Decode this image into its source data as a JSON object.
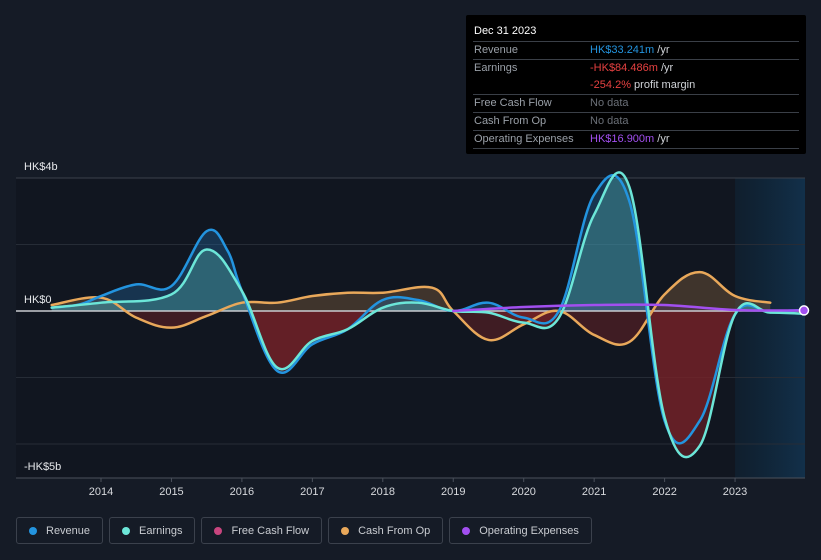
{
  "tooltip": {
    "date": "Dec 31 2023",
    "rows": [
      {
        "label": "Revenue",
        "value": "HK$33.241m",
        "unit": "/yr",
        "color": "#2394df"
      },
      {
        "label": "Earnings",
        "value": "-HK$84.486m",
        "unit": "/yr",
        "color": "#e64141"
      },
      {
        "label": "",
        "value": "-254.2%",
        "unit": "profit margin",
        "color": "#e64141"
      },
      {
        "label": "Free Cash Flow",
        "value": "No data",
        "unit": "",
        "color": "#6b7078"
      },
      {
        "label": "Cash From Op",
        "value": "No data",
        "unit": "",
        "color": "#6b7078"
      },
      {
        "label": "Operating Expenses",
        "value": "HK$16.900m",
        "unit": "/yr",
        "color": "#a24ff0"
      }
    ]
  },
  "legend": [
    {
      "label": "Revenue",
      "color": "#2394df"
    },
    {
      "label": "Earnings",
      "color": "#6ce6d8"
    },
    {
      "label": "Free Cash Flow",
      "color": "#c8457e"
    },
    {
      "label": "Cash From Op",
      "color": "#e9a85a"
    },
    {
      "label": "Operating Expenses",
      "color": "#a24ff0"
    }
  ],
  "chart_data": {
    "type": "area",
    "title": "",
    "xlabel": "",
    "ylabel": "",
    "y_unit": "HK$ billions",
    "ylim": [
      -5,
      4
    ],
    "xlim": [
      2012.8,
      2024.0
    ],
    "y_tick_labels": [
      {
        "value": 4,
        "label": "HK$4b"
      },
      {
        "value": 0,
        "label": "HK$0"
      },
      {
        "value": -5,
        "label": "-HK$5b"
      }
    ],
    "gridlines": [
      4,
      2,
      0,
      -2,
      -4
    ],
    "x_ticks": [
      2014,
      2015,
      2016,
      2017,
      2018,
      2019,
      2020,
      2021,
      2022,
      2023
    ],
    "forecast_shade_start": 2023.0,
    "grid": true,
    "legend_position": "bottom",
    "series": [
      {
        "name": "Revenue",
        "color": "#2394df",
        "points": [
          [
            2013.3,
            0.1
          ],
          [
            2013.7,
            0.2
          ],
          [
            2014.0,
            0.45
          ],
          [
            2014.5,
            0.8
          ],
          [
            2015.0,
            0.75
          ],
          [
            2015.5,
            2.4
          ],
          [
            2015.8,
            1.8
          ],
          [
            2016.0,
            0.6
          ],
          [
            2016.5,
            -1.8
          ],
          [
            2017.0,
            -1.0
          ],
          [
            2017.5,
            -0.55
          ],
          [
            2018.0,
            0.33
          ],
          [
            2018.5,
            0.33
          ],
          [
            2019.0,
            0.0
          ],
          [
            2019.5,
            0.25
          ],
          [
            2020.0,
            -0.2
          ],
          [
            2020.5,
            0.0
          ],
          [
            2021.0,
            3.5
          ],
          [
            2021.5,
            3.3
          ],
          [
            2022.0,
            -3.3
          ],
          [
            2022.5,
            -3.3
          ],
          [
            2023.0,
            -0.1
          ],
          [
            2023.5,
            -0.02
          ],
          [
            2024.0,
            0.033
          ]
        ]
      },
      {
        "name": "Earnings",
        "color": "#6ce6d8",
        "points": [
          [
            2013.3,
            0.1
          ],
          [
            2014.0,
            0.25
          ],
          [
            2015.0,
            0.5
          ],
          [
            2015.5,
            1.85
          ],
          [
            2016.0,
            0.6
          ],
          [
            2016.5,
            -1.7
          ],
          [
            2017.0,
            -0.9
          ],
          [
            2017.5,
            -0.55
          ],
          [
            2018.0,
            0.1
          ],
          [
            2018.5,
            0.25
          ],
          [
            2019.0,
            0.0
          ],
          [
            2019.5,
            -0.05
          ],
          [
            2020.0,
            -0.35
          ],
          [
            2020.5,
            -0.2
          ],
          [
            2021.0,
            2.9
          ],
          [
            2021.5,
            3.73
          ],
          [
            2022.0,
            -3.2
          ],
          [
            2022.5,
            -4.05
          ],
          [
            2023.0,
            -0.1
          ],
          [
            2023.5,
            -0.05
          ],
          [
            2024.0,
            -0.085
          ]
        ]
      },
      {
        "name": "Free Cash Flow",
        "color": "#c8457e",
        "points": []
      },
      {
        "name": "Cash From Op",
        "color": "#e9a85a",
        "points": [
          [
            2013.3,
            0.18
          ],
          [
            2014.0,
            0.4
          ],
          [
            2014.5,
            -0.2
          ],
          [
            2015.0,
            -0.5
          ],
          [
            2015.5,
            -0.15
          ],
          [
            2016.0,
            0.25
          ],
          [
            2016.5,
            0.25
          ],
          [
            2017.0,
            0.45
          ],
          [
            2017.5,
            0.55
          ],
          [
            2018.0,
            0.55
          ],
          [
            2018.7,
            0.7
          ],
          [
            2019.0,
            0.0
          ],
          [
            2019.5,
            -0.87
          ],
          [
            2020.0,
            -0.4
          ],
          [
            2020.5,
            0.0
          ],
          [
            2021.0,
            -0.72
          ],
          [
            2021.5,
            -0.93
          ],
          [
            2022.0,
            0.5
          ],
          [
            2022.5,
            1.17
          ],
          [
            2023.0,
            0.45
          ],
          [
            2023.5,
            0.25
          ]
        ]
      },
      {
        "name": "Operating Expenses",
        "color": "#a24ff0",
        "points": [
          [
            2019.0,
            0.0
          ],
          [
            2020.0,
            0.12
          ],
          [
            2021.0,
            0.18
          ],
          [
            2022.0,
            0.18
          ],
          [
            2023.0,
            0.03
          ],
          [
            2024.0,
            0.017
          ]
        ]
      }
    ]
  }
}
